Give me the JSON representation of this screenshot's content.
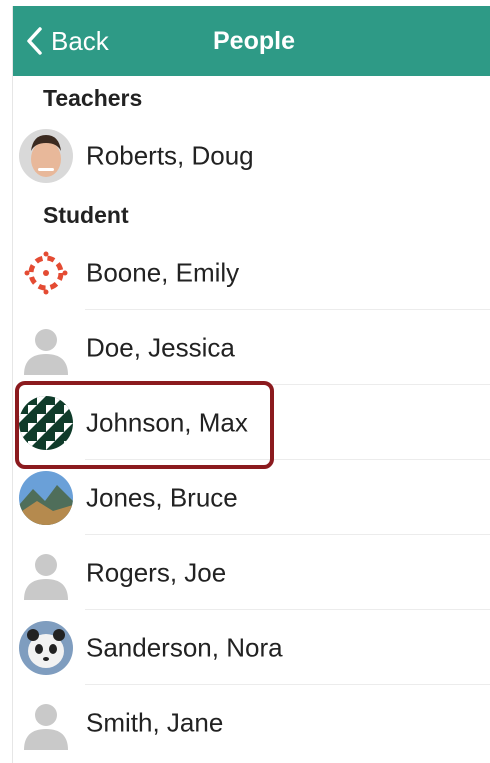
{
  "theme": {
    "accent": "#2e9a86",
    "highlight": "#8b1a1e"
  },
  "nav": {
    "back_label": "Back",
    "title": "People"
  },
  "sections": {
    "teachers": "Teachers",
    "students": "Student"
  },
  "people": [
    {
      "name": "Roberts, Doug",
      "avatar": "photo-man"
    },
    {
      "name": "Boone, Emily",
      "avatar": "canvas-logo"
    },
    {
      "name": "Doe, Jessica",
      "avatar": "default-person"
    },
    {
      "name": "Johnson, Max",
      "avatar": "pattern"
    },
    {
      "name": "Jones, Bruce",
      "avatar": "photo-landscape"
    },
    {
      "name": "Rogers, Joe",
      "avatar": "default-person"
    },
    {
      "name": "Sanderson, Nora",
      "avatar": "photo-panda"
    },
    {
      "name": "Smith, Jane",
      "avatar": "default-person"
    }
  ]
}
